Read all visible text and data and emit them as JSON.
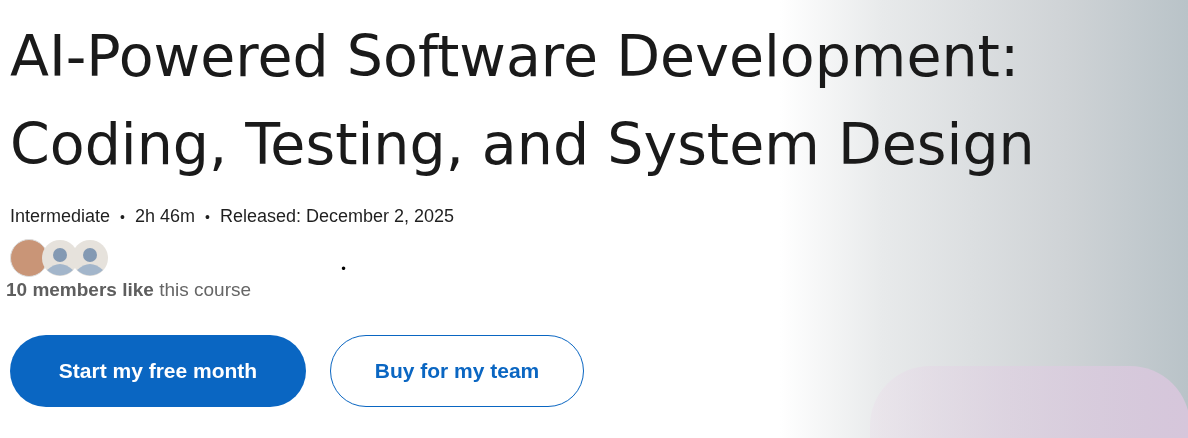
{
  "course": {
    "title_lines": [
      "AI-Powered Software Development:",
      "Coding, Testing, and System Design"
    ],
    "meta": [
      "Intermediate",
      "•",
      "2h 46m",
      "•",
      "Released: December 2, 2025"
    ],
    "avatars": [
      {
        "kind": "photo"
      },
      {
        "kind": "silhouette"
      },
      {
        "kind": "silhouette"
      }
    ],
    "stray_mark": "•",
    "likes": "**10 members like** this course",
    "buttons": [
      {
        "label": "Start my free month",
        "kind": "primary"
      },
      {
        "label": "Buy for my team",
        "kind": "outline"
      }
    ]
  }
}
